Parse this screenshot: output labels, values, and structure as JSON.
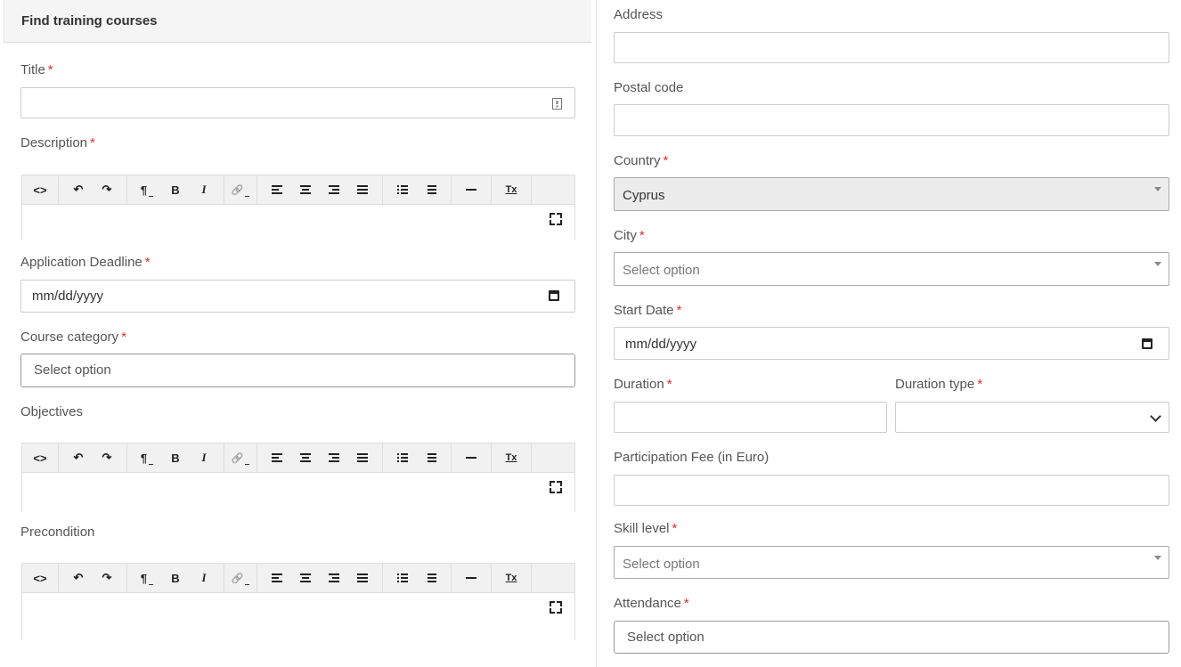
{
  "header": {
    "title": "Find training courses"
  },
  "required_mark": "*",
  "left": {
    "title_label": "Title",
    "description_label": "Description",
    "deadline_label": "Application Deadline",
    "deadline_placeholder": "mm/dd/yyyy",
    "category_label": "Course category",
    "category_placeholder": "Select option",
    "objectives_label": "Objectives",
    "precondition_label": "Precondition"
  },
  "toolbar_icons": {
    "code": "<>",
    "undo": "↶",
    "redo": "↷",
    "paragraph": "¶",
    "bold": "B",
    "italic": "I",
    "link": "🔗",
    "clear_format": "Tx"
  },
  "right": {
    "address_label": "Address",
    "postal_label": "Postal code",
    "country_label": "Country",
    "country_value": "Cyprus",
    "city_label": "City",
    "city_placeholder": "Select option",
    "start_label": "Start Date",
    "start_placeholder": "mm/dd/yyyy",
    "duration_label": "Duration",
    "duration_type_label": "Duration type",
    "fee_label": "Participation Fee (in Euro)",
    "skill_label": "Skill level",
    "skill_placeholder": "Select option",
    "attendance_label": "Attendance",
    "attendance_placeholder": "Select option"
  }
}
